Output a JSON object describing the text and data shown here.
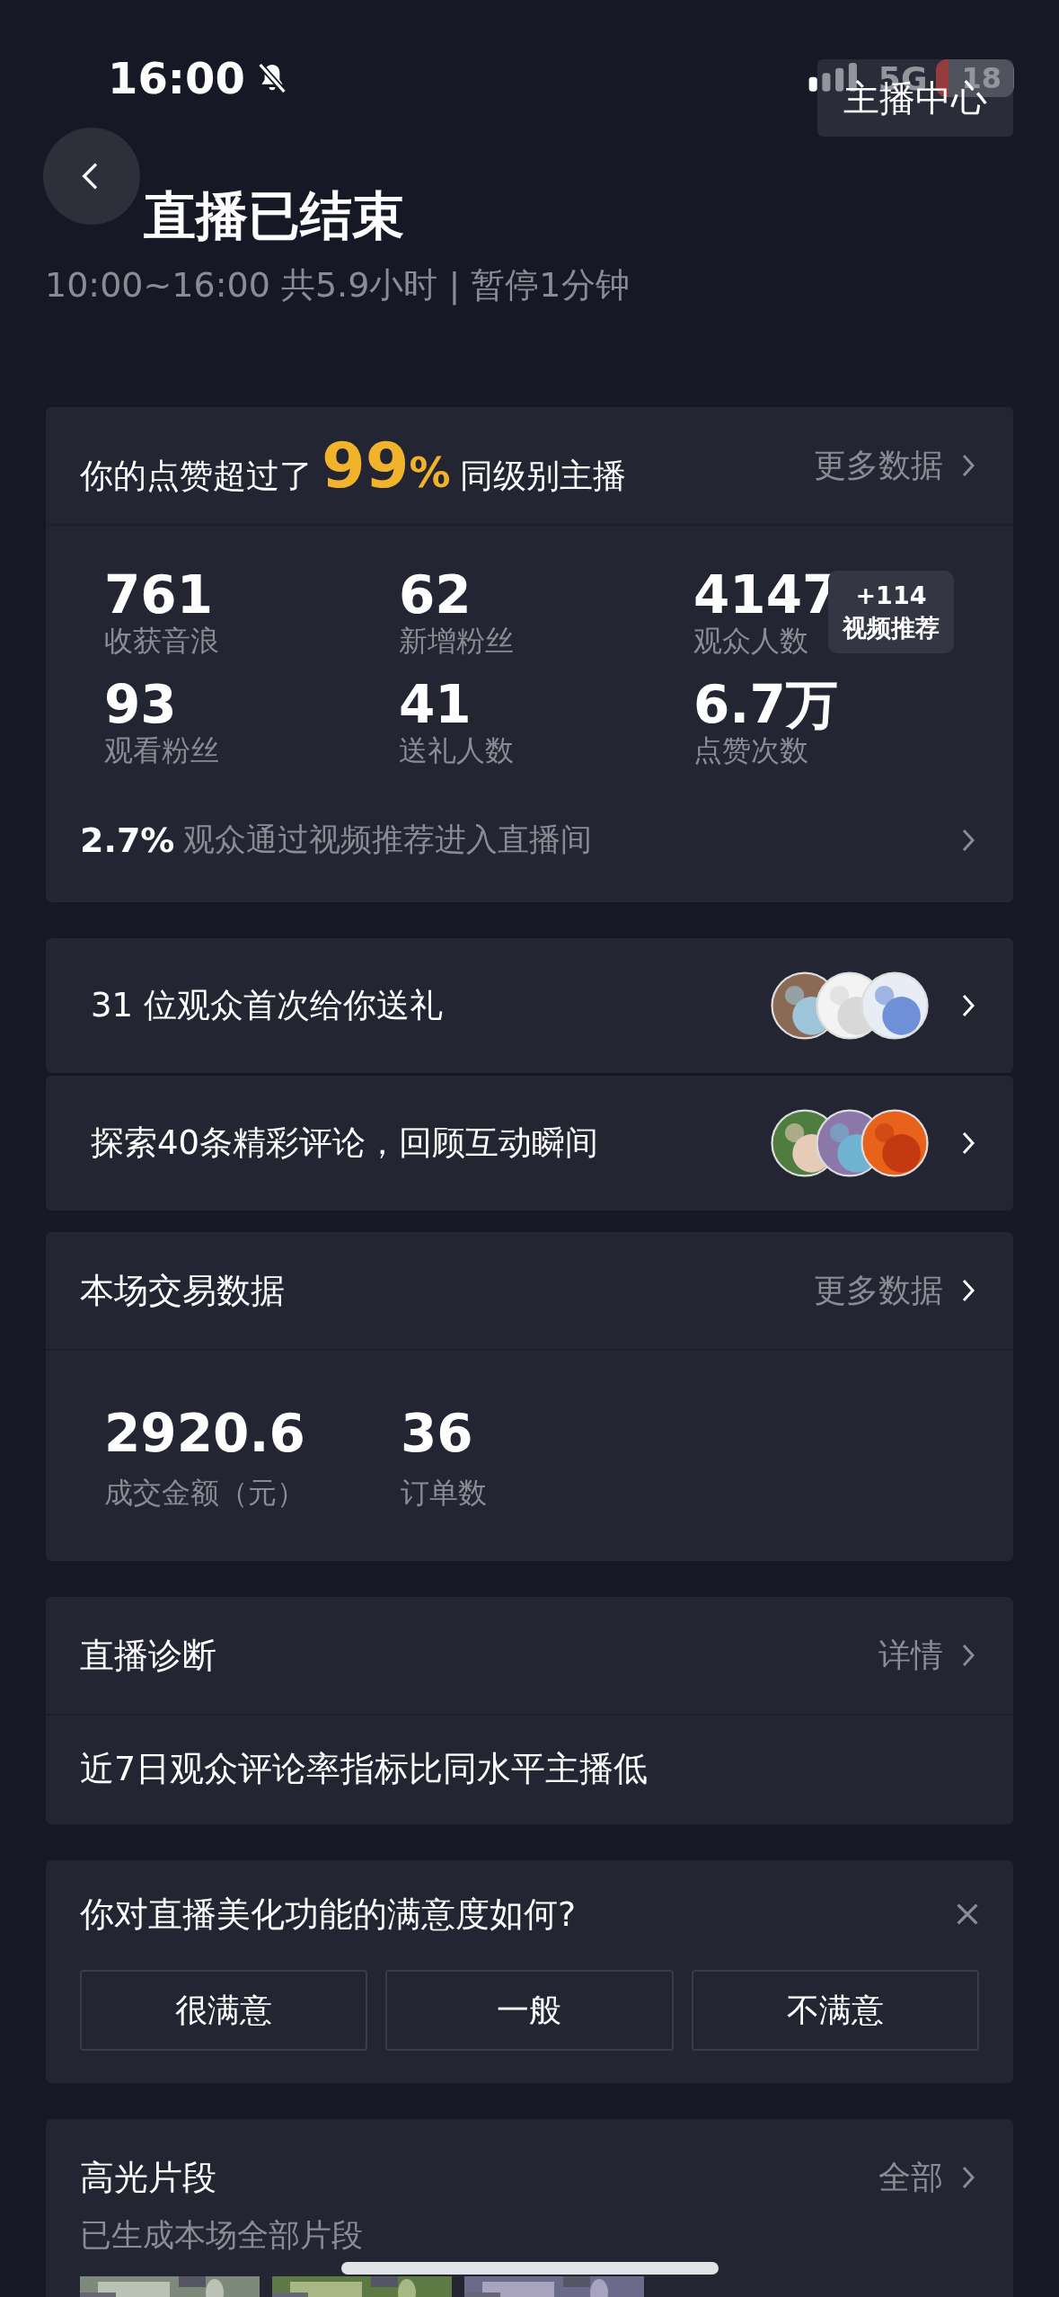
{
  "status_bar": {
    "time": "16:00",
    "muted": true,
    "network": "5G",
    "battery": "18"
  },
  "header": {
    "center_button": "主播中心",
    "title": "直播已结束",
    "subtitle": "10:00~16:00 共5.9小时 | 暂停1分钟"
  },
  "likes_card": {
    "prefix": "你的点赞超过了",
    "percent": "99",
    "percent_sign": "%",
    "suffix": "同级别主播",
    "more": "更多数据",
    "stats": [
      {
        "value": "761",
        "label": "收获音浪"
      },
      {
        "value": "62",
        "label": "新增粉丝"
      },
      {
        "value": "4147",
        "label": "观众人数",
        "badge": {
          "value": "+114",
          "label": "视频推荐"
        }
      },
      {
        "value": "93",
        "label": "观看粉丝"
      },
      {
        "value": "41",
        "label": "送礼人数"
      },
      {
        "value": "6.7万",
        "label": "点赞次数"
      }
    ],
    "footer": {
      "value": "2.7%",
      "text": "观众通过视频推荐进入直播间"
    }
  },
  "list_rows": [
    {
      "text": "31 位观众首次给你送礼"
    },
    {
      "text": "探索40条精彩评论，回顾互动瞬间"
    }
  ],
  "trade_card": {
    "title": "本场交易数据",
    "more": "更多数据",
    "stats": [
      {
        "value": "2920.6",
        "label": "成交金额（元）"
      },
      {
        "value": "36",
        "label": "订单数"
      }
    ]
  },
  "diagnosis_card": {
    "title": "直播诊断",
    "more": "详情",
    "text": "近7日观众评论率指标比同水平主播低"
  },
  "survey_card": {
    "question": "你对直播美化功能的满意度如何?",
    "options": [
      "很满意",
      "一般",
      "不满意"
    ]
  },
  "highlights_card": {
    "title": "高光片段",
    "more": "全部",
    "subtitle": "已生成本场全部片段"
  }
}
